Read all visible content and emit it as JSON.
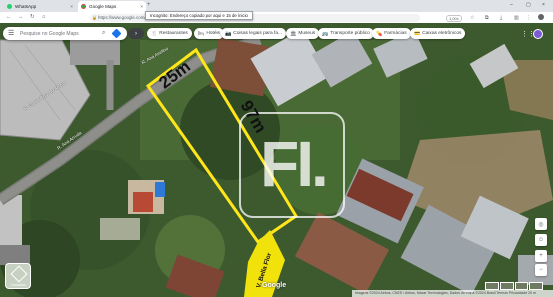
{
  "browser": {
    "tabs": [
      {
        "label": "WhatsApp",
        "icon": "whatsapp-icon"
      },
      {
        "label": "Google Maps",
        "icon": "google-maps-icon"
      }
    ],
    "tab_close_glyph": "×",
    "new_tab_glyph": "+",
    "window_controls": [
      "–",
      "▢",
      "×"
    ],
    "nav": {
      "back": "←",
      "forward": "→",
      "reload": "↻",
      "home": "⌂"
    },
    "url": "https://www.google.com/maps/@-20.0543,-44.0315,88m/data=!3m1!1e3",
    "zoom_badge": "1,00x",
    "share_tooltip": "Incognito: Endereço copiado por aqui e 15 de ínicio"
  },
  "maps": {
    "search_placeholder": "Pesquise no Google Maps",
    "menu_glyph": "☰",
    "search_glyph": "⌕",
    "chips": [
      {
        "label": "Restaurantes",
        "icon": "restaurant-icon",
        "glyph": "🍴"
      },
      {
        "label": "Hotéis",
        "icon": "hotel-icon",
        "glyph": "🛏"
      },
      {
        "label": "Coisas legais para fa...",
        "icon": "camera-icon",
        "glyph": "📷"
      },
      {
        "label": "Museus",
        "icon": "museum-icon",
        "glyph": "🏛"
      },
      {
        "label": "Transporte público",
        "icon": "transit-icon",
        "glyph": "🚌"
      },
      {
        "label": "Farmácias",
        "icon": "pharmacy-icon",
        "glyph": "💊"
      },
      {
        "label": "Caixas eletrônicos",
        "icon": "atm-icon",
        "glyph": "💳"
      }
    ],
    "more_chips_glyph": "›",
    "apps_glyph": "⋮⋮",
    "right_controls": {
      "location": "◎",
      "zoom_in": "+",
      "zoom_out": "−",
      "pegman": "☺"
    },
    "layers_label": "Camadas",
    "brand": "Google",
    "attribution": "Imagens ©2024 Airbus, CNES / Airbus, Maxar Technologies, Dados do mapa ©2024  Brasil  Termos  Privacidade  20 m",
    "road_labels": {
      "main_road": "R. Santa Cruz do Ampar",
      "side_road": "R. Ana Arruda",
      "upper_road": "R. Ana Avelino",
      "bella_flor": "V. Bella Flor"
    },
    "plot_labels": {
      "width": "25m",
      "length": "97m"
    },
    "watermark": "FI."
  },
  "colors": {
    "plot_outline": "#ffe61a",
    "street_highlight": "#f2e20c",
    "chip_dark": "#3c4043",
    "brand_blue": "#1a73e8"
  }
}
